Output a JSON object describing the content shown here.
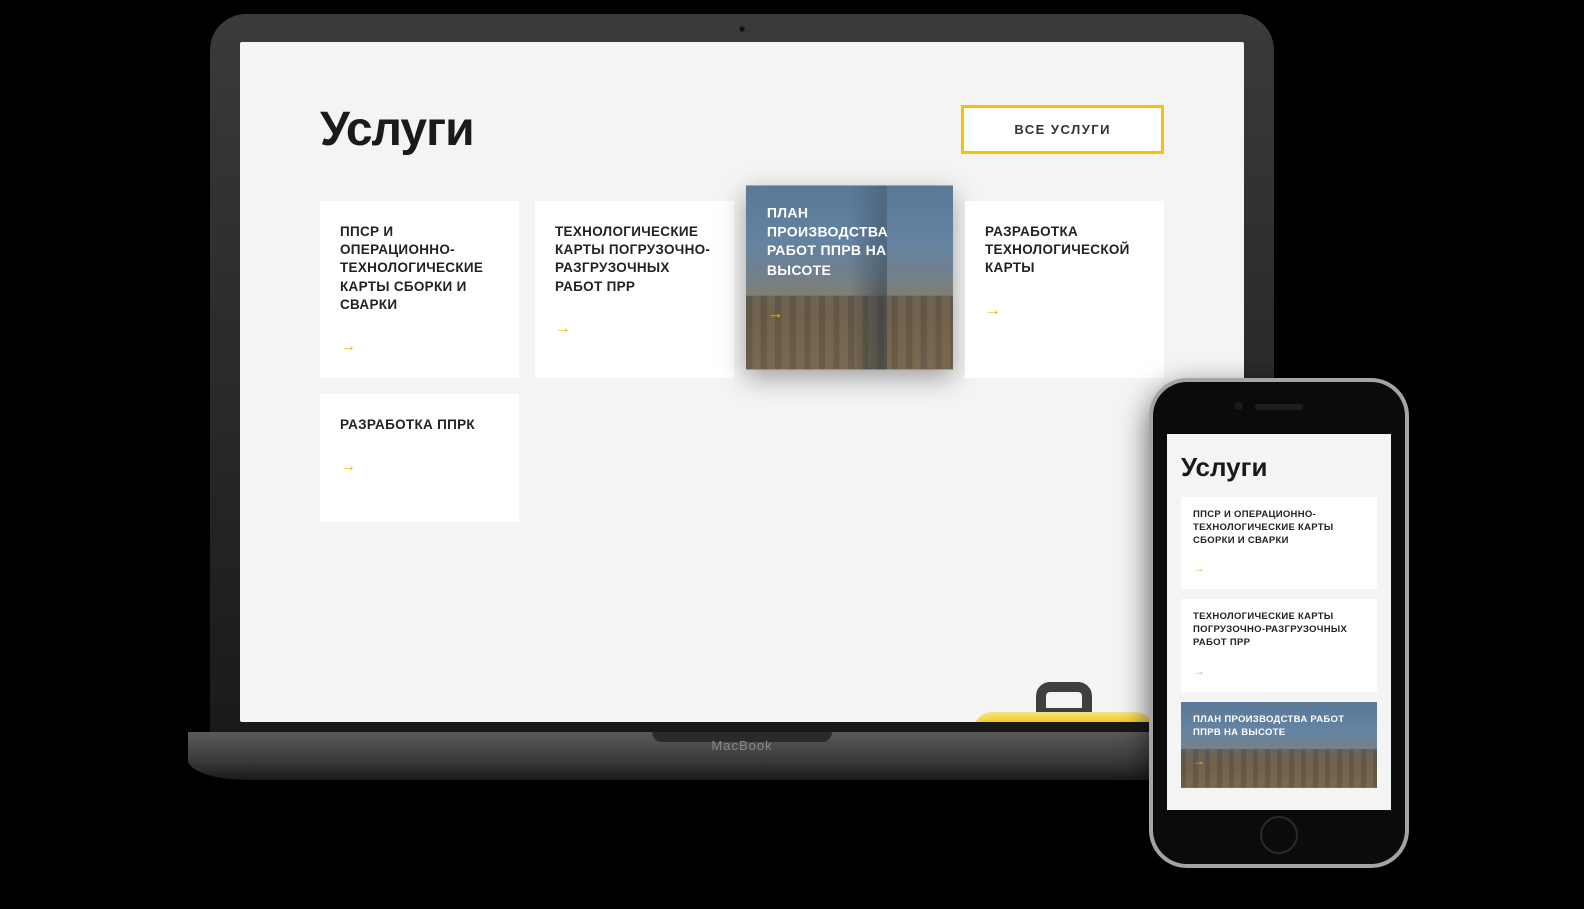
{
  "laptop": {
    "brand": "MacBook",
    "page": {
      "title": "Услуги",
      "all_button": "ВСЕ УСЛУГИ",
      "cards": [
        {
          "title": "ППСР И ОПЕРАЦИОННО-ТЕХНОЛОГИЧЕСКИЕ КАРТЫ СБОРКИ И СВАРКИ",
          "featured": false
        },
        {
          "title": "ТЕХНОЛОГИЧЕСКИЕ КАРТЫ ПОГРУЗОЧНО-РАЗГРУЗОЧНЫХ РАБОТ ПРР",
          "featured": false
        },
        {
          "title": "ПЛАН ПРОИЗВОДСТВА РАБОТ ППРВ НА ВЫСОТЕ",
          "featured": true
        },
        {
          "title": "РАЗРАБОТКА ТЕХНОЛОГИЧЕСКОЙ КАРТЫ",
          "featured": false
        },
        {
          "title": "РАЗРАБОТКА ППРК",
          "featured": false
        }
      ]
    }
  },
  "phone": {
    "page": {
      "title": "Услуги",
      "cards": [
        {
          "title": "ППСР И ОПЕРАЦИОННО-ТЕХНОЛОГИЧЕСКИЕ КАРТЫ СБОРКИ И СВАРКИ",
          "featured": false
        },
        {
          "title": "ТЕХНОЛОГИЧЕСКИЕ КАРТЫ ПОГРУЗОЧНО-РАЗГРУЗОЧНЫХ РАБОТ ПРР",
          "featured": false
        },
        {
          "title": "ПЛАН ПРОИЗВОДСТВА РАБОТ ППРВ НА ВЫСОТЕ",
          "featured": true
        }
      ]
    }
  },
  "colors": {
    "accent": "#f7c200",
    "arrow": "#f7b500"
  }
}
